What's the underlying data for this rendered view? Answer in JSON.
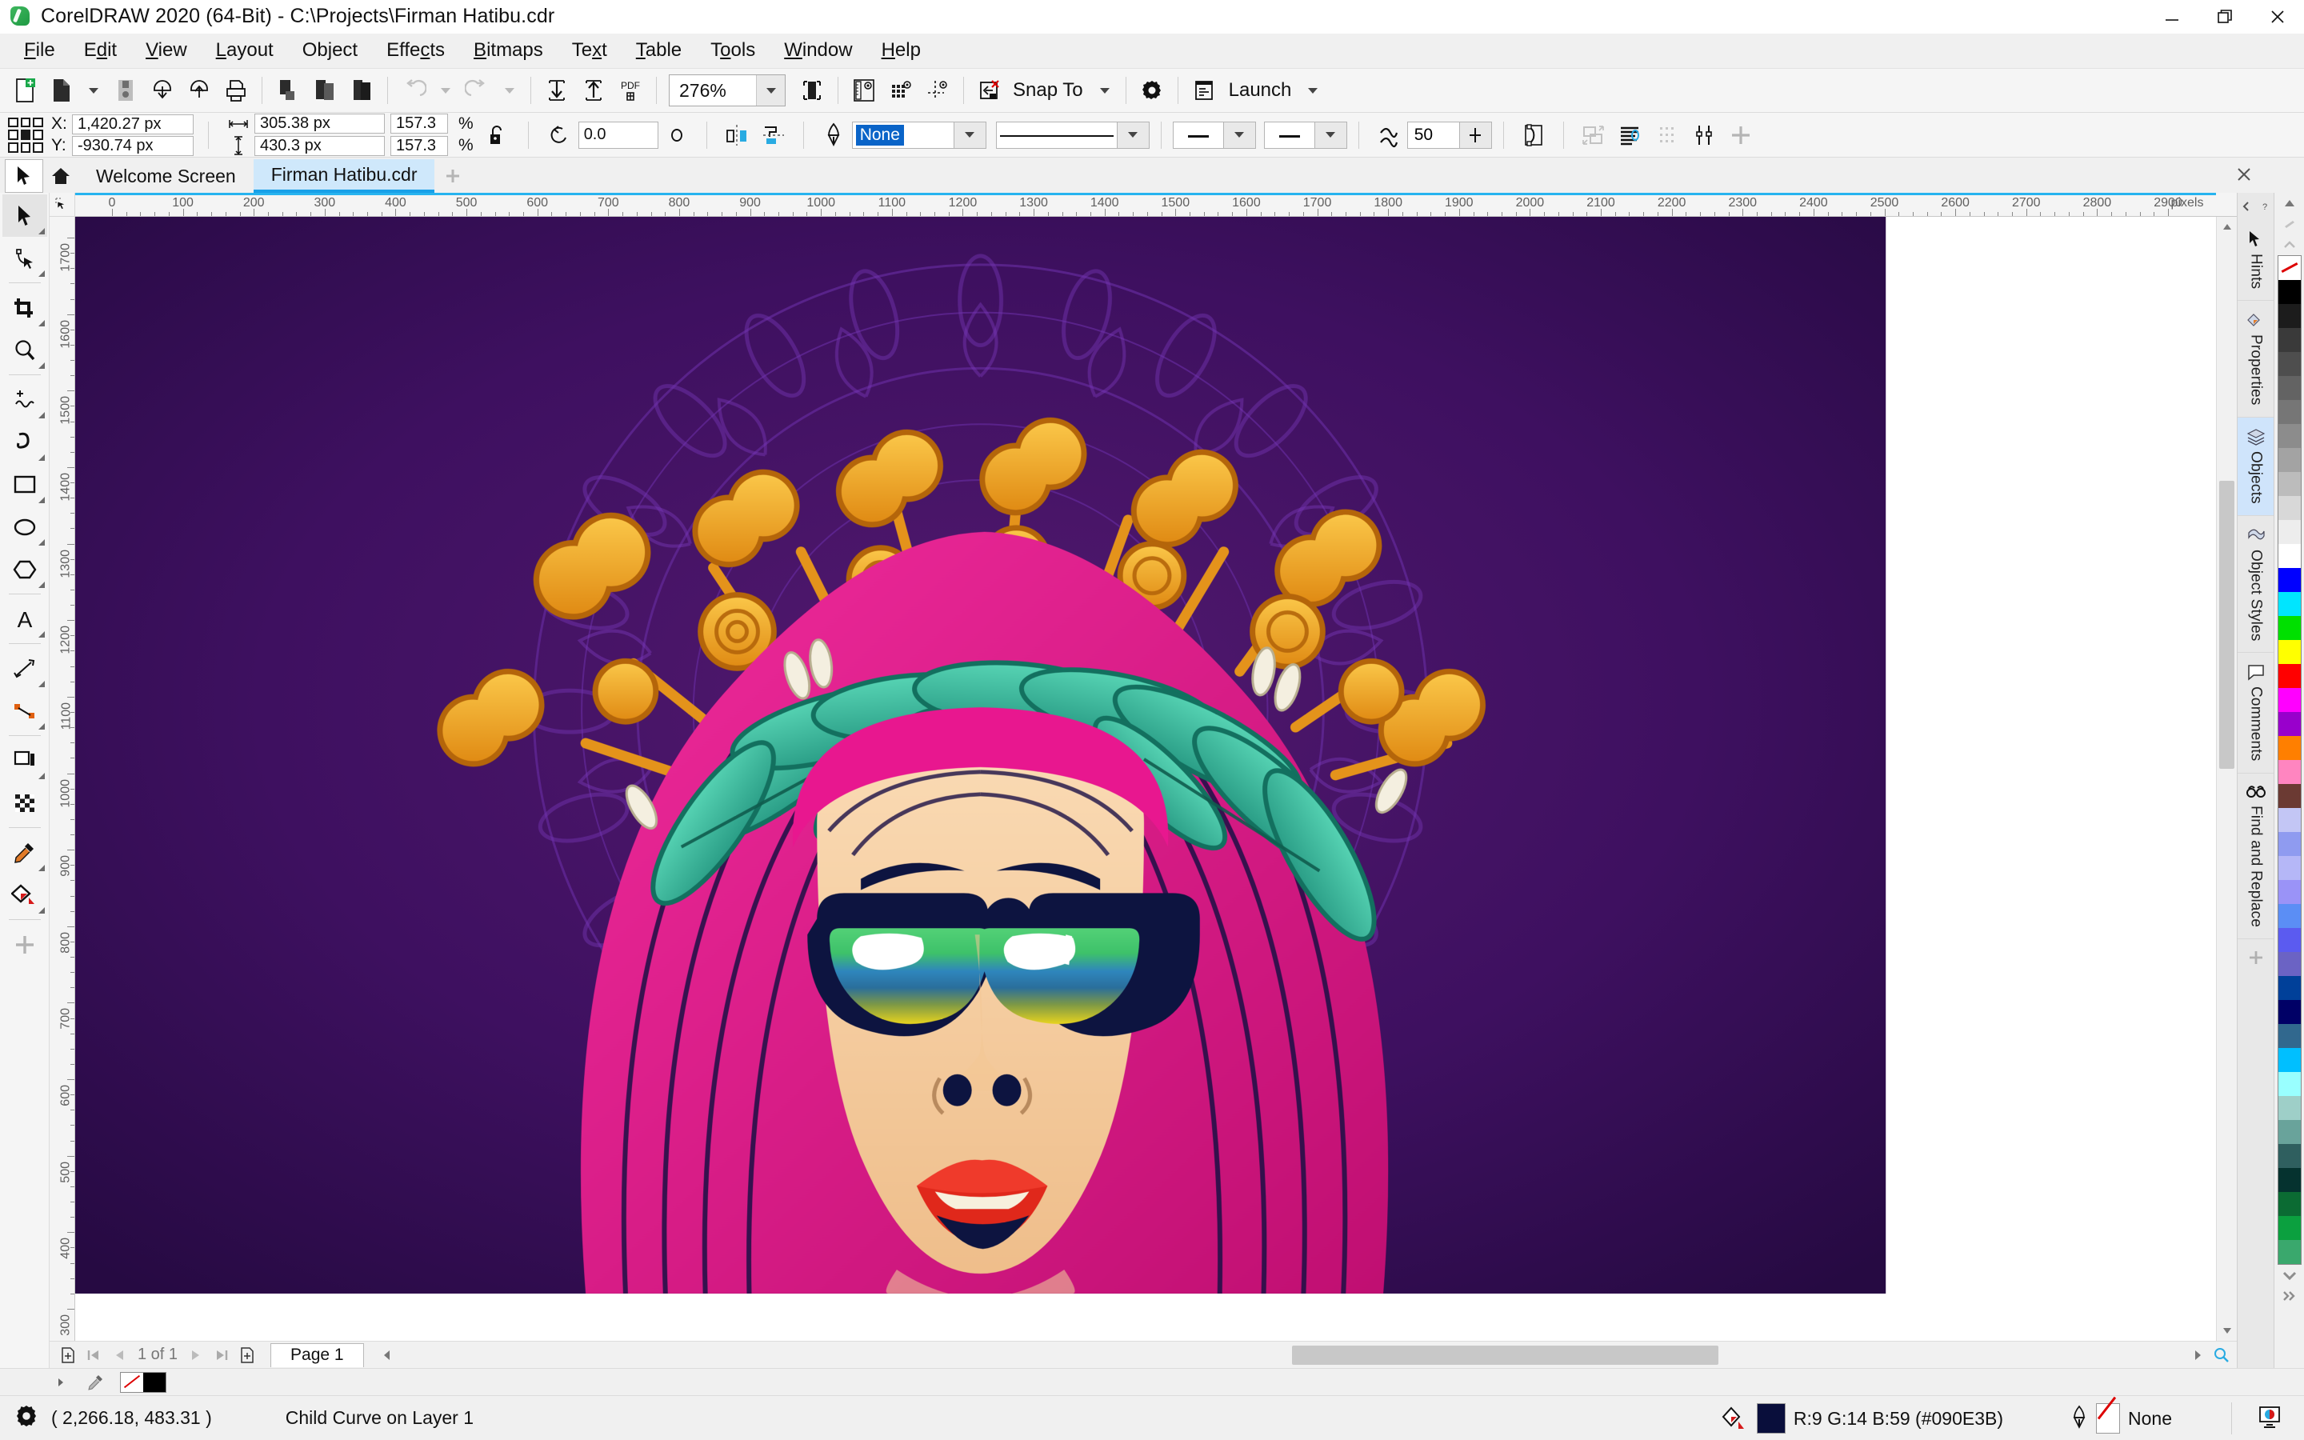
{
  "window": {
    "title": "CorelDRAW 2020 (64-Bit) - C:\\Projects\\Firman Hatibu.cdr",
    "minimize_label": "Minimize",
    "restore_label": "Restore",
    "close_label": "Close"
  },
  "menubar": {
    "items": [
      "File",
      "Edit",
      "View",
      "Layout",
      "Object",
      "Effects",
      "Bitmaps",
      "Text",
      "Table",
      "Tools",
      "Window",
      "Help"
    ]
  },
  "standard_toolbar": {
    "buttons": [
      "new-document",
      "open-document",
      "open-dropdown",
      "save-document",
      "import",
      "export",
      "print",
      "cut",
      "copy",
      "paste",
      "undo",
      "undo-dropdown",
      "redo",
      "redo-dropdown",
      "import-arrow",
      "export-arrow",
      "publish-to-pdf"
    ],
    "zoom_level": "276%",
    "full_screen_preview": "full-screen-preview",
    "show_rulers": "show-rulers",
    "show_grid": "show-grid",
    "show_guidelines": "show-guidelines",
    "clear_transform": "clear-transform",
    "snap_to_label": "Snap To",
    "options_label": "Options",
    "launch_label": "Launch"
  },
  "property_bar": {
    "x_label": "X:",
    "x_value": "1,420.27 px",
    "y_label": "Y:",
    "y_value": "-930.74 px",
    "width_value": "305.38 px",
    "height_value": "430.3 px",
    "scale_x": "157.3",
    "scale_y": "157.3",
    "percent_sign": "%",
    "lock_ratio": "unlocked",
    "rotation_value": "0.0",
    "mirror_horizontal": "mirror-horizontal",
    "mirror_vertical": "mirror-vertical",
    "outline_width": "None",
    "outline_style_preview": "solid-line",
    "line_start_arrow": "none",
    "line_end_arrow": "none",
    "wrap_value": "50",
    "text_wrap": "text-wrap",
    "to_front_back": "order",
    "convert_outline": "convert-to-curves",
    "edit_text": "edit-text",
    "weld": "weld",
    "transparency": "transparency",
    "add_more": "+"
  },
  "tabs": {
    "tool_picker": "pick-tool",
    "home_icon": "home-icon",
    "items": [
      {
        "label": "Welcome Screen",
        "active": false
      },
      {
        "label": "Firman Hatibu.cdr",
        "active": true
      }
    ],
    "add_label": "+"
  },
  "toolbox": {
    "tools": [
      {
        "name": "pick-tool",
        "selected": true
      },
      {
        "name": "shape-tool",
        "selected": false
      },
      {
        "name": "crop-tool",
        "selected": false
      },
      {
        "name": "zoom-tool",
        "selected": false
      },
      {
        "name": "freehand-tool",
        "selected": false
      },
      {
        "name": "artistic-media-tool",
        "selected": false
      },
      {
        "name": "rectangle-tool",
        "selected": false
      },
      {
        "name": "ellipse-tool",
        "selected": false
      },
      {
        "name": "polygon-tool",
        "selected": false
      },
      {
        "name": "text-tool",
        "selected": false
      },
      {
        "name": "parallel-dimension-tool",
        "selected": false
      },
      {
        "name": "straight-line-connector-tool",
        "selected": false
      },
      {
        "name": "drop-shadow-tool",
        "selected": false
      },
      {
        "name": "transparency-tool",
        "selected": false
      },
      {
        "name": "color-eyedropper-tool",
        "selected": false
      },
      {
        "name": "interactive-fill-tool",
        "selected": false
      },
      {
        "name": "add-tool",
        "selected": false
      }
    ]
  },
  "rulers": {
    "unit": "pixels",
    "horizontal_ticks": [
      0,
      100,
      200,
      300,
      400,
      500,
      600,
      700,
      800,
      900,
      1000,
      1100,
      1200,
      1300,
      1400,
      1500,
      1600,
      1700,
      1800,
      1900,
      2000,
      2100,
      2200,
      2300,
      2400,
      2500,
      2600,
      2700,
      2800,
      2900
    ],
    "vertical_ticks": [
      1700,
      1600,
      1500,
      1400,
      1300,
      1200,
      1100,
      1000,
      900,
      800,
      700,
      600,
      500,
      400,
      300
    ]
  },
  "page_navigator": {
    "add_page_before": "add-page-before",
    "first": "first-page",
    "previous": "previous-page",
    "counter": "1 of 1",
    "next": "next-page",
    "last": "last-page",
    "add_page_after": "add-page-after",
    "page_tab": "Page 1"
  },
  "dock": {
    "items": [
      {
        "label": "Hints",
        "icon": "hints-icon",
        "active": false
      },
      {
        "label": "Properties",
        "icon": "properties-icon",
        "active": false
      },
      {
        "label": "Objects",
        "icon": "objects-icon",
        "active": true
      },
      {
        "label": "Object Styles",
        "icon": "object-styles-icon",
        "active": false
      },
      {
        "label": "Comments",
        "icon": "comments-icon",
        "active": false
      },
      {
        "label": "Find and Replace",
        "icon": "find-replace-icon",
        "active": false
      }
    ],
    "add_label": "+"
  },
  "palette": {
    "colors": [
      "none",
      "#000000",
      "#1c1c1c",
      "#3a3a3a",
      "#4e4e4e",
      "#636363",
      "#767676",
      "#8c8c8c",
      "#a3a3a3",
      "#bcbcbc",
      "#d8d8d8",
      "#ededed",
      "#ffffff",
      "#0000ff",
      "#00e5ff",
      "#00e000",
      "#ffff00",
      "#ff0000",
      "#ff00ff",
      "#9900cc",
      "#ff7f00",
      "#ff85c0",
      "#6b3a33",
      "#c3c6f5",
      "#8f9bf0",
      "#b5b7f7",
      "#9a93f7",
      "#5b8ef5",
      "#5b5bf0",
      "#6b63c4",
      "#004099",
      "#000066",
      "#31688e",
      "#00bfff",
      "#99ffff",
      "#9ecfc8",
      "#69a39b",
      "#2f5f5f",
      "#05322f",
      "#0b6b33",
      "#0ba03f",
      "#3aa86d"
    ]
  },
  "status_bar": {
    "cursor_position": "( 2,266.18, 483.31 )",
    "selection_info": "Child Curve on Layer 1",
    "fill_color_hex": "#090E3B",
    "fill_color_text": "R:9 G:14 B:59 (#090E3B)",
    "outline_text": "None",
    "color_proof_icon": "color-proof-icon"
  },
  "artwork": {
    "title": "Woman with floral crown and mirrored sunglasses",
    "background_color": "#3e1060",
    "mandala_color": "#5a2080",
    "hair_color": "#e8178f",
    "hair_dark": "#0d1440",
    "skin_color": "#f6cda0",
    "leaf_color": "#3fbda0",
    "gold_color": "#f0a323",
    "lens_top": "#ffffff",
    "lens_green": "#3fcf5c",
    "lens_blue": "#2d7fb8",
    "lens_yellow": "#e8d41f",
    "lips_color": "#ef3a2b"
  }
}
